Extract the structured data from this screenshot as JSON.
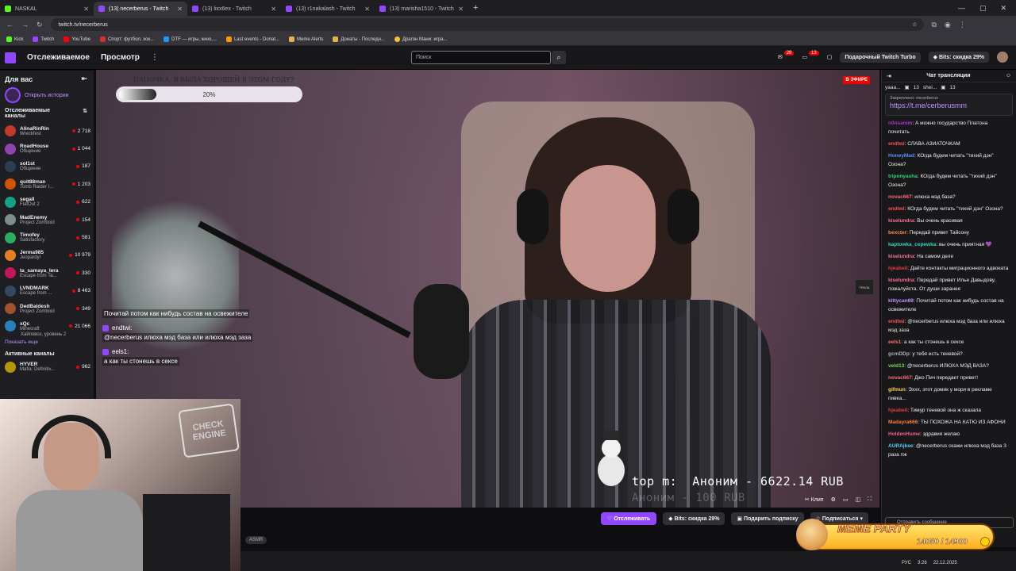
{
  "browser": {
    "tabs": [
      {
        "title": "NASKAL"
      },
      {
        "title": "(13) necerberus - Twitch"
      },
      {
        "title": "(13) lixx6ex - Twitch"
      },
      {
        "title": "(13) r1nakalash - Twitch"
      },
      {
        "title": "(13) marisha1510 - Twitch"
      }
    ],
    "url": "twitch.tv/necerberus",
    "bookmarks": [
      "Kick",
      "Twitch",
      "YouTube",
      "Спорт: футбол, хок...",
      "DTF — игры, кино,...",
      "Last events - Donat...",
      "Meme Alerts",
      "Донаты - Последн...",
      "Драгон Мани: игра..."
    ]
  },
  "twitch_nav": {
    "following": "Отслеживаемое",
    "browse": "Просмотр",
    "search_placeholder": "Поиск",
    "notif_count_1": "28",
    "notif_count_2": "13",
    "gift_turbo": "Подарочный Twitch Turbo",
    "bits_sale": "Bits: скидка 29%"
  },
  "sidebar": {
    "for_you": "Для вас",
    "open_stories": "Открыть истории",
    "followed_channels": "Отслеживаемые каналы",
    "channels": [
      {
        "name": "AlinaRinRin",
        "game": "Wreckfest",
        "viewers": "2 718",
        "color": "#c0392b"
      },
      {
        "name": "RoadHouse",
        "game": "Общение",
        "viewers": "1 044",
        "color": "#8e44ad"
      },
      {
        "name": "sol1st",
        "game": "Общение",
        "viewers": "187",
        "color": "#2c3e50"
      },
      {
        "name": "quit88man",
        "game": "Tomb Raider I...",
        "viewers": "1 203",
        "color": "#d35400"
      },
      {
        "name": "segall",
        "game": "FlatOut 2",
        "viewers": "622",
        "color": "#16a085"
      },
      {
        "name": "MadEnemy",
        "game": "Project Zomboid",
        "viewers": "154",
        "color": "#7f8c8d"
      },
      {
        "name": "Timofey",
        "game": "Satisfactory",
        "viewers": "581",
        "color": "#27ae60"
      },
      {
        "name": "Jerma985",
        "game": "Jeopardy!",
        "viewers": "10 979",
        "color": "#e67e22"
      },
      {
        "name": "ta_samaya_lera",
        "game": "Escape from Ta...",
        "viewers": "330",
        "color": "#c2185b"
      },
      {
        "name": "LVNDMARK",
        "game": "Escape from ...",
        "viewers": "8 463",
        "color": "#34495e"
      },
      {
        "name": "DedBaldesh",
        "game": "Project Zomboid",
        "viewers": "349",
        "color": "#a0522d"
      },
      {
        "name": "xQc",
        "game": "Minecraft",
        "viewers": "21 066",
        "color": "#2980b9"
      }
    ],
    "hype_note": "Хайповоз, уровень 2",
    "show_more": "Показать еще",
    "active_channels": "Активные каналы",
    "active": [
      {
        "name": "HYVER",
        "game": "Mafia: Definitiv...",
        "viewers": "962",
        "color": "#b7950b"
      }
    ]
  },
  "player": {
    "poll_question": "ПАПОЧКА, Я БЫЛА ХОРОШЕЙ В ЭТОМ ГОДУ?",
    "poll_percent": "20%",
    "poll_fraction": 0.2,
    "live_label": "В ЭФИРЕ",
    "corner_logo": "TRIVIA",
    "overlay_messages": [
      {
        "user": "",
        "text": "Почитай потом как нибудь состав на освежителе"
      },
      {
        "user": "endtwi:",
        "text": "@necerberus илюха мэд база или илюха мэд заза"
      },
      {
        "user": "eels1:",
        "text": "а как ты стонешь в сексе"
      }
    ],
    "donation_line": "top m:  Аноним - 6622.14 RUB",
    "donation_ghost": "Аноним - 100 RUB",
    "clip_label": "Клип",
    "webcam_sign": "CHECK ENGINE"
  },
  "actions": {
    "follow": "Отслеживать",
    "bits": "Bits: скидка 29%",
    "gift_sub": "Подарить подписку",
    "subscribe": "Подписаться",
    "tag": "ASMR"
  },
  "chat": {
    "title": "Чат трансляции",
    "top_user": "yaaa...",
    "top_count": "13",
    "top_user2": "shei...",
    "top_count2": "13",
    "pinned_by": "Закреплено: necerberus",
    "pinned_link": "https://t.me/cerberusmm",
    "messages": [
      {
        "user": "n0nsanim",
        "color": "#b92bd9",
        "text": "А можно государство Платона почитать"
      },
      {
        "user": "endtwi",
        "color": "#ff4b4b",
        "text": "СЛАВА АЗИАТОЧКАМ"
      },
      {
        "user": "HoneyMad",
        "color": "#5c8dff",
        "text": "КОгда будем читать \"тихий дэн\" Озона?"
      },
      {
        "user": "triponyasha",
        "color": "#2ed47a",
        "text": "КОгда будем читать \"тихий дэн\" Озона?"
      },
      {
        "user": "novac667",
        "color": "#ff6b6b",
        "text": "илюха мэд база?"
      },
      {
        "user": "endtwi",
        "color": "#ff4b4b",
        "text": "КОгда будем читать \"тихий дэн\" Озона?"
      },
      {
        "user": "kiselundra",
        "color": "#ff6b9a",
        "text": "Вы очень красивая"
      },
      {
        "user": "bexcter",
        "color": "#ff8a3d",
        "text": "Передай привет Тайсону"
      },
      {
        "user": "kaptowka_cepewka",
        "color": "#2ed4c6",
        "text": "вы очень приятная 💜"
      },
      {
        "user": "kiselundra",
        "color": "#ff6b9a",
        "text": "На самом деле"
      },
      {
        "user": "hjeabeil",
        "color": "#e63a3a",
        "text": "Дайте контакты миграционного адвоката"
      },
      {
        "user": "kiselundra",
        "color": "#ff6b9a",
        "text": "Передай привет Илье Давыдову, пожалуйста. От души заранее"
      },
      {
        "user": "kittycan69",
        "color": "#bf94ff",
        "text": "Почитай потом как нибудь состав на освежителе"
      },
      {
        "user": "endtwi",
        "color": "#ff4b4b",
        "text": "@necerberus илюха мэд база или илюха мэд заза"
      },
      {
        "user": "eels1",
        "color": "#ff6b6b",
        "text": "а как ты стонешь в сексе"
      },
      {
        "user": "gcmDDp",
        "color": "#adadb8",
        "text": "у тебя есть теневой?"
      },
      {
        "user": "veld13",
        "color": "#7bd84b",
        "text": "@necerberus ИЛЮХА МЭД ВАЗА?"
      },
      {
        "user": "novac667",
        "color": "#ff6b6b",
        "text": "Джо Пич передает привет!"
      },
      {
        "user": "gifmun",
        "color": "#ffd34d",
        "text": "Эххх, этот домик у моря в рекламе пивка..."
      },
      {
        "user": "hjeabeil",
        "color": "#e63a3a",
        "text": "Тимур теневой она ж сказала"
      },
      {
        "user": "Madayra666",
        "color": "#ff7a3d",
        "text": "ТЫ ПОХОЖА НА КАТЮ ИЗ АФОНИ"
      },
      {
        "user": "HoldenHume",
        "color": "#ff5c8a",
        "text": "здравия желаю"
      },
      {
        "user": "AURAjkee",
        "color": "#5cc8ff",
        "text": "@necerberus скажи илюха мэд база 3 раза пж"
      }
    ],
    "input_placeholder": "Отправить сообщение"
  },
  "meme_overlay": {
    "title": "MEME PARTY",
    "score": "14050 / 14900"
  },
  "taskbar": {
    "lang": "РУС",
    "time": "3:26",
    "date": "22.12.2025"
  }
}
